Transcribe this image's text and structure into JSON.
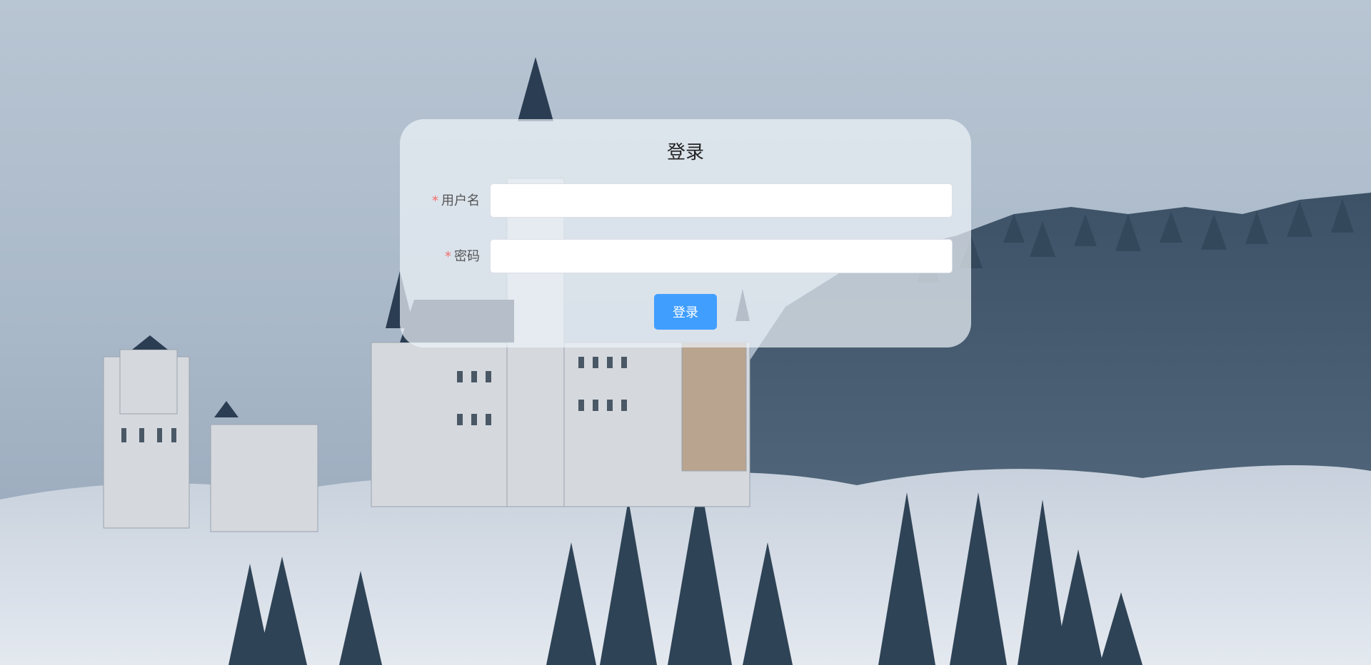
{
  "login": {
    "title": "登录",
    "username": {
      "required_mark": "*",
      "label": "用户名",
      "value": "",
      "placeholder": ""
    },
    "password": {
      "required_mark": "*",
      "label": "密码",
      "value": "",
      "placeholder": ""
    },
    "submit_label": "登录"
  },
  "colors": {
    "primary_button": "#409eff",
    "required_mark": "#f56c6c"
  }
}
